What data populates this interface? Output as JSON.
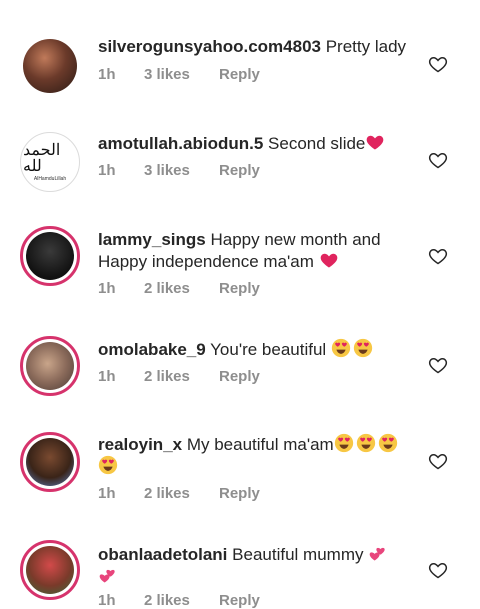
{
  "comments": [
    {
      "username": "silverogunsyahoo.com4803",
      "text": "Pretty lady",
      "emojis": [],
      "time": "1h",
      "likes": "3 likes",
      "reply": "Reply"
    },
    {
      "username": "amotullah.abiodun.5",
      "text": "Second slide",
      "emojis": [
        "red-heart"
      ],
      "time": "1h",
      "likes": "3 likes",
      "reply": "Reply"
    },
    {
      "username": "lammy_sings",
      "text": "Happy new month and Happy independence ma'am",
      "emojis": [
        "red-heart"
      ],
      "time": "1h",
      "likes": "2 likes",
      "reply": "Reply"
    },
    {
      "username": "omolabake_9",
      "text": "You're beautiful",
      "emojis": [
        "heart-eyes",
        "heart-eyes"
      ],
      "time": "1h",
      "likes": "2 likes",
      "reply": "Reply"
    },
    {
      "username": "realoyin_x",
      "text": "My beautiful ma'am",
      "emojis": [
        "heart-eyes",
        "heart-eyes",
        "heart-eyes",
        "heart-eyes"
      ],
      "time": "1h",
      "likes": "2 likes",
      "reply": "Reply"
    },
    {
      "username": "obanlaadetolani",
      "text": "Beautiful mummy",
      "emojis": [
        "two-hearts",
        "two-hearts"
      ],
      "time": "1h",
      "likes": "2 likes",
      "reply": "Reply"
    }
  ],
  "avatar_logo_text": "AlHamduLillah",
  "colors": {
    "meta": "#8e8e8e",
    "heart_red": "#e0245e",
    "story_ring": "#d6336c"
  }
}
